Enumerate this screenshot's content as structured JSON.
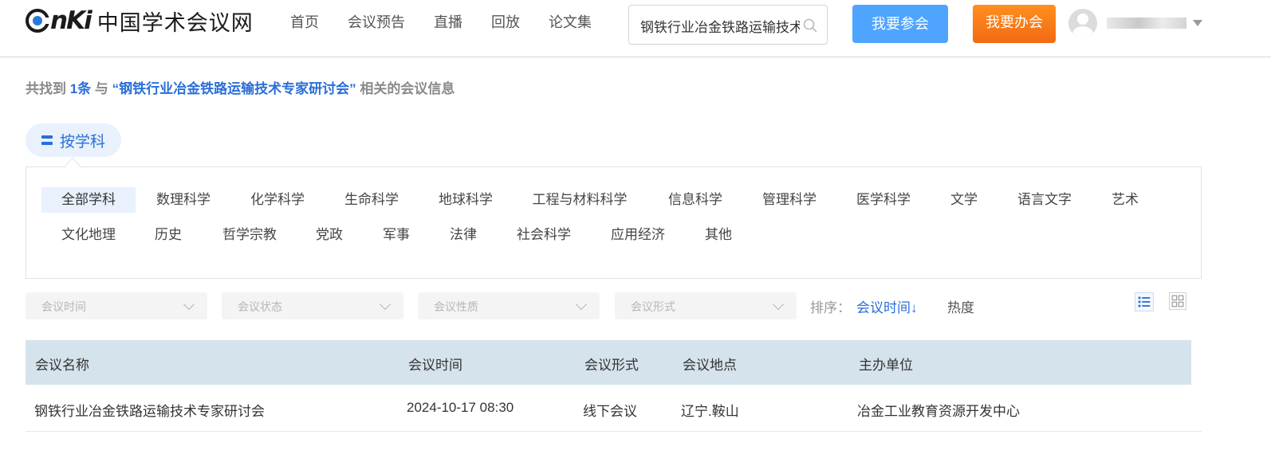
{
  "header": {
    "logo_mark": "nKi",
    "logo_text": "中国学术会议网",
    "nav": [
      "首页",
      "会议预告",
      "直播",
      "回放",
      "论文集"
    ],
    "search_value": "钢铁行业冶金铁路运输技术专家研讨会",
    "join_label": "我要参会",
    "host_label": "我要办会"
  },
  "summary": {
    "prefix": "共找到 ",
    "count": "1条",
    "mid": " 与 ",
    "query": "“钢铁行业冶金铁路运输技术专家研讨会”",
    "suffix": " 相关的会议信息"
  },
  "subject_filter": {
    "tab_label": "按学科",
    "row1": [
      "全部学科",
      "数理科学",
      "化学科学",
      "生命科学",
      "地球科学",
      "工程与材料科学",
      "信息科学",
      "管理科学",
      "医学科学",
      "文学",
      "语言文字",
      "艺术"
    ],
    "row2": [
      "文化地理",
      "历史",
      "哲学宗教",
      "党政",
      "军事",
      "法律",
      "社会科学",
      "应用经济",
      "其他"
    ],
    "active": "全部学科"
  },
  "filters": {
    "time": "会议时间",
    "status": "会议状态",
    "nature": "会议性质",
    "form": "会议形式"
  },
  "sort": {
    "label": "排序：",
    "time": "会议时间↓",
    "hot": "热度"
  },
  "table": {
    "columns": [
      "会议名称",
      "会议时间",
      "会议形式",
      "会议地点",
      "主办单位"
    ],
    "rows": [
      {
        "name": "钢铁行业冶金铁路运输技术专家研讨会",
        "time": "2024-10-17 08:30",
        "form": "线下会议",
        "location": "辽宁.鞍山",
        "organizer": "冶金工业教育资源开发中心"
      }
    ]
  },
  "colors": {
    "accent": "#2a6ed8",
    "join_button": "#4ea4ff",
    "host_button": "#f26a13",
    "table_header": "#d5e3ec"
  }
}
